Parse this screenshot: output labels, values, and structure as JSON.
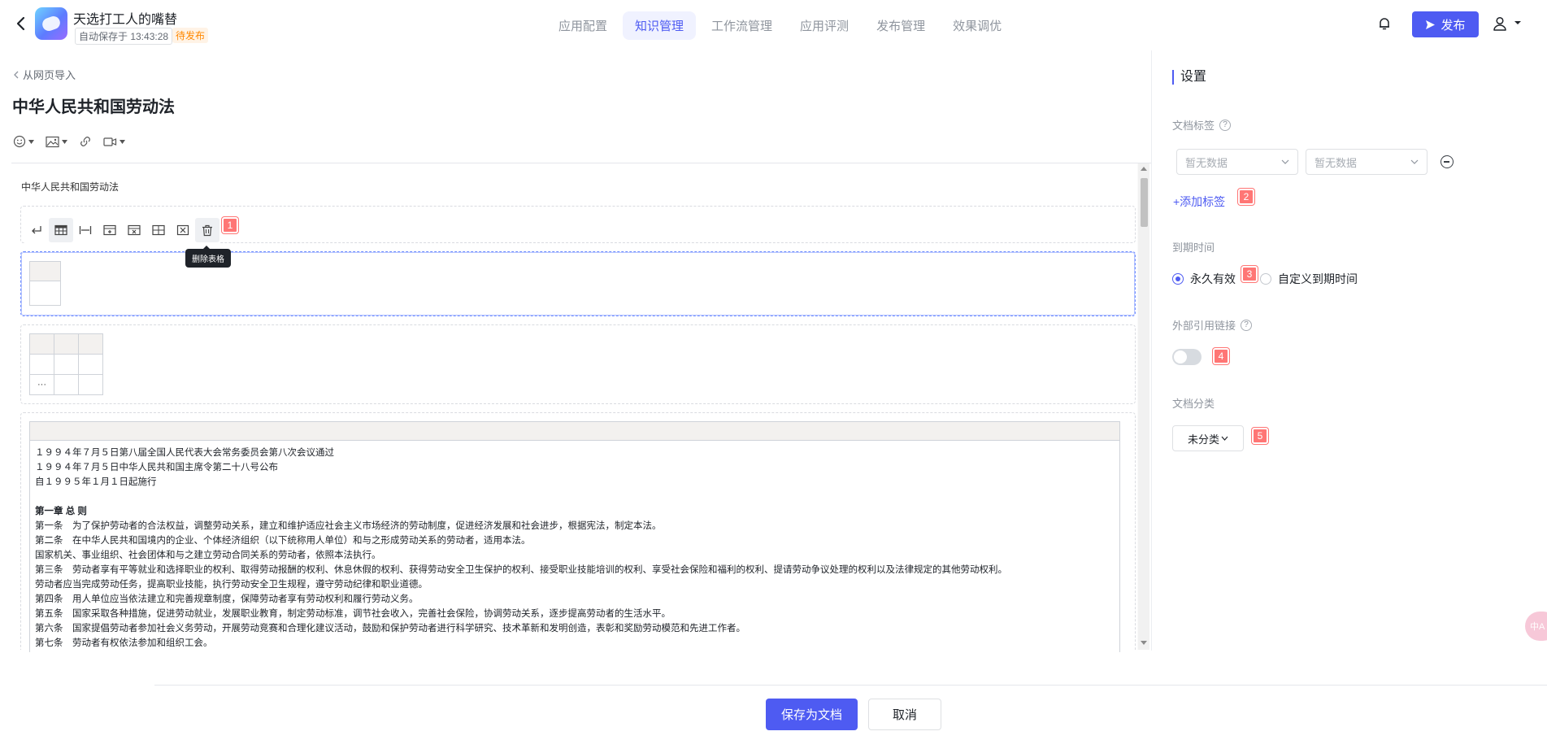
{
  "header": {
    "app_name": "天选打工人的嘴替",
    "autosave": "自动保存于 13:43:28",
    "status_badge": "待发布",
    "tabs": [
      {
        "label": "应用配置"
      },
      {
        "label": "知识管理",
        "active": true
      },
      {
        "label": "工作流管理"
      },
      {
        "label": "应用评测"
      },
      {
        "label": "发布管理"
      },
      {
        "label": "效果调优"
      }
    ],
    "publish_label": "发布"
  },
  "editor": {
    "back_link": "从网页导入",
    "doc_title": "中华人民共和国劳动法",
    "content_heading": "中华人民共和国劳动法",
    "tooltip": "删除表格",
    "law_lines": [
      {
        "text": "１９９４年７月５日第八届全国人民代表大会常务委员会第八次会议通过"
      },
      {
        "text": "１９９４年７月５日中华人民共和国主席令第二十八号公布"
      },
      {
        "text": "自１９９５年１月１日起施行"
      },
      {
        "text": ""
      },
      {
        "text": "第一章 总 则",
        "bold": true
      },
      {
        "text": "第一条　为了保护劳动者的合法权益，调整劳动关系，建立和维护适应社会主义市场经济的劳动制度，促进经济发展和社会进步，根据宪法，制定本法。"
      },
      {
        "text": "第二条　在中华人民共和国境内的企业、个体经济组织（以下统称用人单位）和与之形成劳动关系的劳动者，适用本法。"
      },
      {
        "text": "国家机关、事业组织、社会团体和与之建立劳动合同关系的劳动者，依照本法执行。"
      },
      {
        "text": "第三条　劳动者享有平等就业和选择职业的权利、取得劳动报酬的权利、休息休假的权利、获得劳动安全卫生保护的权利、接受职业技能培训的权利、享受社会保险和福利的权利、提请劳动争议处理的权利以及法律规定的其他劳动权利。"
      },
      {
        "text": "劳动者应当完成劳动任务，提高职业技能，执行劳动安全卫生规程，遵守劳动纪律和职业道德。"
      },
      {
        "text": "第四条　用人单位应当依法建立和完善规章制度，保障劳动者享有劳动权利和履行劳动义务。"
      },
      {
        "text": "第五条　国家采取各种措施，促进劳动就业，发展职业教育，制定劳动标准，调节社会收入，完善社会保险，协调劳动关系，逐步提高劳动者的生活水平。"
      },
      {
        "text": "第六条　国家提倡劳动者参加社会义务劳动，开展劳动竞赛和合理化建议活动，鼓励和保护劳动者进行科学研究、技术革新和发明创造，表彰和奖励劳动模范和先进工作者。"
      },
      {
        "text": "第七条　劳动者有权依法参加和组织工会。"
      }
    ],
    "small_table_ellipsis": "···"
  },
  "settings": {
    "title": "设置",
    "doc_tags_label": "文档标签",
    "help_glyph": "?",
    "tag_select_1": "暂无数据",
    "tag_select_2": "暂无数据",
    "add_tag": "+添加标签",
    "expiry_label": "到期时间",
    "expiry_options": [
      "永久有效",
      "自定义到期时间"
    ],
    "external_link_label": "外部引用链接",
    "category_label": "文档分类",
    "category_value": "未分类"
  },
  "markers": [
    "1",
    "2",
    "3",
    "4",
    "5"
  ],
  "float_ball_text": "中A",
  "footer": {
    "save_label": "保存为文档",
    "cancel_label": "取消"
  },
  "colors": {
    "accent": "#4e5bf2",
    "pending": "#ff8800",
    "marker": "#ff7675"
  }
}
